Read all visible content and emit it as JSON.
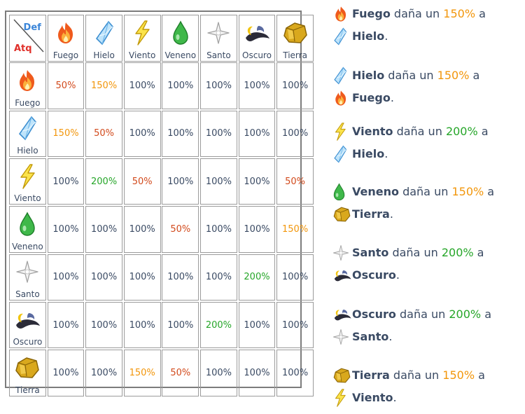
{
  "table": {
    "corner": {
      "def": "Def",
      "atq": "Atq"
    },
    "elements": [
      {
        "key": "fuego",
        "label": "Fuego",
        "icon": "fire-icon"
      },
      {
        "key": "hielo",
        "label": "Hielo",
        "icon": "ice-crystal-icon"
      },
      {
        "key": "viento",
        "label": "Viento",
        "icon": "lightning-icon"
      },
      {
        "key": "veneno",
        "label": "Veneno",
        "icon": "poison-drop-icon"
      },
      {
        "key": "santo",
        "label": "Santo",
        "icon": "holy-star-icon"
      },
      {
        "key": "oscuro",
        "label": "Oscuro",
        "icon": "dark-moon-icon"
      },
      {
        "key": "tierra",
        "label": "Tierra",
        "icon": "earth-rock-icon"
      }
    ],
    "rows": [
      [
        "50%",
        "150%",
        "100%",
        "100%",
        "100%",
        "100%",
        "100%"
      ],
      [
        "150%",
        "50%",
        "100%",
        "100%",
        "100%",
        "100%",
        "100%"
      ],
      [
        "100%",
        "200%",
        "50%",
        "100%",
        "100%",
        "100%",
        "50%"
      ],
      [
        "100%",
        "100%",
        "100%",
        "50%",
        "100%",
        "100%",
        "150%"
      ],
      [
        "100%",
        "100%",
        "100%",
        "100%",
        "100%",
        "200%",
        "100%"
      ],
      [
        "100%",
        "100%",
        "100%",
        "100%",
        "200%",
        "100%",
        "100%"
      ],
      [
        "100%",
        "100%",
        "150%",
        "50%",
        "100%",
        "100%",
        "100%"
      ]
    ],
    "value_colors": {
      "50%": "#d24a1c",
      "150%": "#f2960b",
      "200%": "#26a629",
      "100%": "#3a4a63"
    }
  },
  "legend": {
    "connector_1": "daña un",
    "connector_2": "a",
    "items": [
      {
        "attacker": "Fuego",
        "pct": "150%",
        "defender": "Hielo"
      },
      {
        "attacker": "Hielo",
        "pct": "150%",
        "defender": "Fuego"
      },
      {
        "attacker": "Viento",
        "pct": "200%",
        "defender": "Hielo"
      },
      {
        "attacker": "Veneno",
        "pct": "150%",
        "defender": "Tierra"
      },
      {
        "attacker": "Santo",
        "pct": "200%",
        "defender": "Oscuro"
      },
      {
        "attacker": "Oscuro",
        "pct": "200%",
        "defender": "Santo"
      },
      {
        "attacker": "Tierra",
        "pct": "150%",
        "defender": "Viento"
      }
    ]
  }
}
